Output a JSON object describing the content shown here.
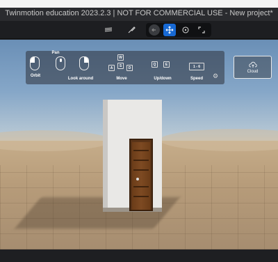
{
  "window": {
    "title": "Twinmotion education 2023.2.3 | NOT FOR COMMERCIAL USE - New project*"
  },
  "toolbar": {
    "buttons": [
      {
        "icon": "layers-icon"
      },
      {
        "icon": "brush-icon"
      },
      {
        "icon": "back-arrow-icon"
      },
      {
        "icon": "move-icon",
        "active": true
      },
      {
        "icon": "orbit-icon"
      },
      {
        "icon": "expand-icon"
      }
    ]
  },
  "controls": {
    "orbit_label": "Orbit",
    "pan_label": "Pan",
    "lookaround_label": "Look around",
    "move_label": "Move",
    "updown_label": "Up/down",
    "speed_label": "Speed",
    "keys": {
      "w": "W",
      "a": "A",
      "s": "S",
      "d": "D",
      "q": "Q",
      "e": "E",
      "speed": "1 - 6"
    },
    "cloud_label": "Cloud"
  },
  "colors": {
    "accent": "#1769d4",
    "toolbar_bg": "#1d1e21",
    "title_bg": "#2a2b2f"
  }
}
